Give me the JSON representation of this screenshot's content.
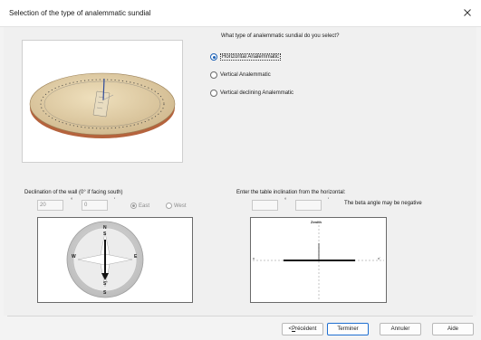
{
  "window": {
    "title": "Selection of the type of analemmatic sundial"
  },
  "question": {
    "label": "What type of analemmatic sundial do you select?",
    "options": [
      {
        "label": "Horizontal Analemmatic",
        "checked": true
      },
      {
        "label": "Vertical Analemmatic",
        "checked": false
      },
      {
        "label": "Vertical declining Analemmatic",
        "checked": false
      }
    ]
  },
  "declination": {
    "label": "Declination of the wall (0° if facing south)",
    "degrees": "20",
    "degree_symbol": "°",
    "minutes": "0",
    "minute_symbol": "'",
    "east_label": "East",
    "west_label": "West",
    "east_checked": true
  },
  "inclination": {
    "label": "Enter the table inclination from the horizontal:",
    "degree_symbol": "°",
    "minute_symbol": "'",
    "note": "The beta angle may be negative"
  },
  "compass": {
    "n": "N",
    "s_top": "S",
    "w": "W",
    "e": "E",
    "s_inner": "S'",
    "s_bottom": "S"
  },
  "diagram": {
    "zenith": "Zenith",
    "left": "x",
    "right": "x'"
  },
  "buttons": {
    "previous_underlined": "P",
    "previous_rest": "récédent",
    "previous_prefix": "< ",
    "finish": "Terminer",
    "cancel": "Annuler",
    "help": "Aide"
  },
  "colors": {
    "accent": "#1a5fb4",
    "dial_face": "#d9c49a",
    "dial_edge": "#a0522d"
  }
}
